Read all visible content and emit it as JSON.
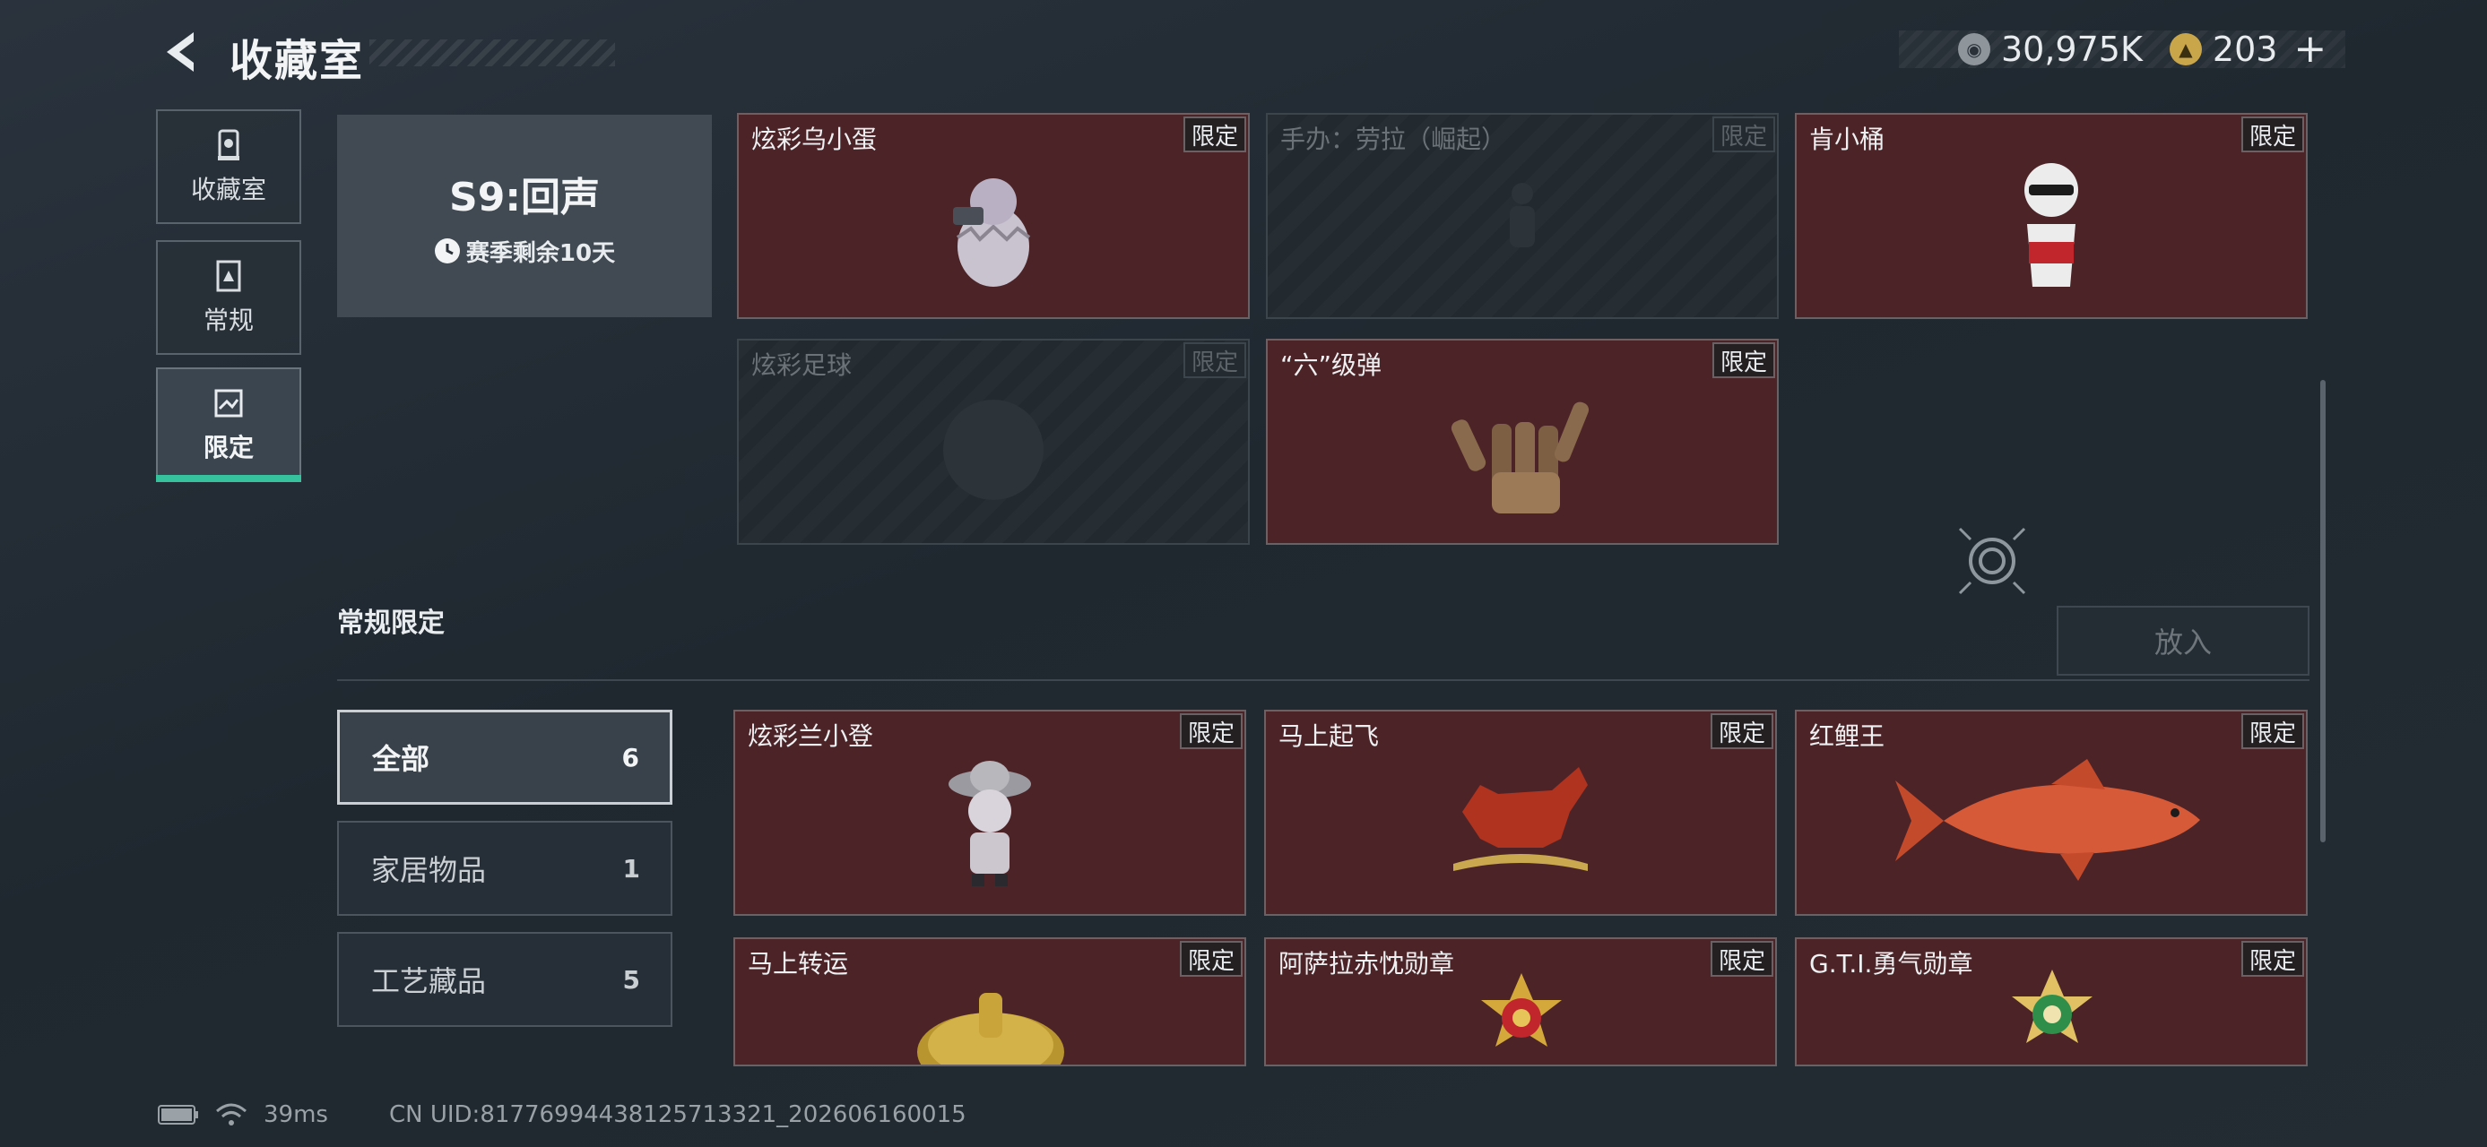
{
  "header": {
    "title": "收藏室"
  },
  "currency": {
    "coins": "30,975K",
    "gold": "203"
  },
  "sidebar": {
    "items": [
      {
        "label": "收藏室"
      },
      {
        "label": "常规"
      },
      {
        "label": "限定"
      }
    ]
  },
  "season": {
    "title": "S9:回声",
    "subtitle": "赛季剩余10天"
  },
  "season_items": [
    {
      "name": "炫彩乌小蛋",
      "tag": "限定"
    },
    {
      "name": "手办：劳拉（崛起）",
      "tag": "限定"
    },
    {
      "name": "肯小桶",
      "tag": "限定"
    },
    {
      "name": "炫彩足球",
      "tag": "限定"
    },
    {
      "name": "“六”级弹",
      "tag": "限定"
    }
  ],
  "section": {
    "title": "常规限定",
    "put_button": "放入"
  },
  "filters": [
    {
      "label": "全部",
      "count": "6"
    },
    {
      "label": "家居物品",
      "count": "1"
    },
    {
      "label": "工艺藏品",
      "count": "5"
    }
  ],
  "items": [
    {
      "name": "炫彩兰小登",
      "tag": "限定"
    },
    {
      "name": "马上起飞",
      "tag": "限定"
    },
    {
      "name": "红鲤王",
      "tag": "限定"
    },
    {
      "name": "马上转运",
      "tag": "限定"
    },
    {
      "name": "阿萨拉赤忱勋章",
      "tag": "限定"
    },
    {
      "name": "G.T.I.勇气勋章",
      "tag": "限定"
    }
  ],
  "status": {
    "ping": "39ms",
    "uid": "CN UID:8177699443812571332​1_202606160015"
  }
}
